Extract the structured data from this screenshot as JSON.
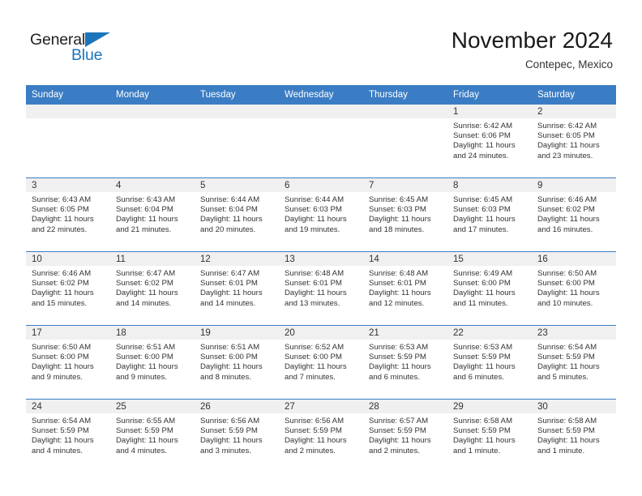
{
  "brand": {
    "name_part1": "General",
    "name_part2": "Blue",
    "logo_shape": "triangle-icon",
    "accent_color": "#1b75bb"
  },
  "header": {
    "title": "November 2024",
    "location": "Contepec, Mexico"
  },
  "theme": {
    "header_row_color": "#3b7dc4",
    "daynum_band_color": "#f0f0f0",
    "text_color": "#333333"
  },
  "calendar": {
    "weekday_headers": [
      "Sunday",
      "Monday",
      "Tuesday",
      "Wednesday",
      "Thursday",
      "Friday",
      "Saturday"
    ],
    "weeks": [
      [
        {
          "day": "",
          "sunrise": "",
          "sunset": "",
          "daylight1": "",
          "daylight2": ""
        },
        {
          "day": "",
          "sunrise": "",
          "sunset": "",
          "daylight1": "",
          "daylight2": ""
        },
        {
          "day": "",
          "sunrise": "",
          "sunset": "",
          "daylight1": "",
          "daylight2": ""
        },
        {
          "day": "",
          "sunrise": "",
          "sunset": "",
          "daylight1": "",
          "daylight2": ""
        },
        {
          "day": "",
          "sunrise": "",
          "sunset": "",
          "daylight1": "",
          "daylight2": ""
        },
        {
          "day": "1",
          "sunrise": "Sunrise: 6:42 AM",
          "sunset": "Sunset: 6:06 PM",
          "daylight1": "Daylight: 11 hours",
          "daylight2": "and 24 minutes."
        },
        {
          "day": "2",
          "sunrise": "Sunrise: 6:42 AM",
          "sunset": "Sunset: 6:05 PM",
          "daylight1": "Daylight: 11 hours",
          "daylight2": "and 23 minutes."
        }
      ],
      [
        {
          "day": "3",
          "sunrise": "Sunrise: 6:43 AM",
          "sunset": "Sunset: 6:05 PM",
          "daylight1": "Daylight: 11 hours",
          "daylight2": "and 22 minutes."
        },
        {
          "day": "4",
          "sunrise": "Sunrise: 6:43 AM",
          "sunset": "Sunset: 6:04 PM",
          "daylight1": "Daylight: 11 hours",
          "daylight2": "and 21 minutes."
        },
        {
          "day": "5",
          "sunrise": "Sunrise: 6:44 AM",
          "sunset": "Sunset: 6:04 PM",
          "daylight1": "Daylight: 11 hours",
          "daylight2": "and 20 minutes."
        },
        {
          "day": "6",
          "sunrise": "Sunrise: 6:44 AM",
          "sunset": "Sunset: 6:03 PM",
          "daylight1": "Daylight: 11 hours",
          "daylight2": "and 19 minutes."
        },
        {
          "day": "7",
          "sunrise": "Sunrise: 6:45 AM",
          "sunset": "Sunset: 6:03 PM",
          "daylight1": "Daylight: 11 hours",
          "daylight2": "and 18 minutes."
        },
        {
          "day": "8",
          "sunrise": "Sunrise: 6:45 AM",
          "sunset": "Sunset: 6:03 PM",
          "daylight1": "Daylight: 11 hours",
          "daylight2": "and 17 minutes."
        },
        {
          "day": "9",
          "sunrise": "Sunrise: 6:46 AM",
          "sunset": "Sunset: 6:02 PM",
          "daylight1": "Daylight: 11 hours",
          "daylight2": "and 16 minutes."
        }
      ],
      [
        {
          "day": "10",
          "sunrise": "Sunrise: 6:46 AM",
          "sunset": "Sunset: 6:02 PM",
          "daylight1": "Daylight: 11 hours",
          "daylight2": "and 15 minutes."
        },
        {
          "day": "11",
          "sunrise": "Sunrise: 6:47 AM",
          "sunset": "Sunset: 6:02 PM",
          "daylight1": "Daylight: 11 hours",
          "daylight2": "and 14 minutes."
        },
        {
          "day": "12",
          "sunrise": "Sunrise: 6:47 AM",
          "sunset": "Sunset: 6:01 PM",
          "daylight1": "Daylight: 11 hours",
          "daylight2": "and 14 minutes."
        },
        {
          "day": "13",
          "sunrise": "Sunrise: 6:48 AM",
          "sunset": "Sunset: 6:01 PM",
          "daylight1": "Daylight: 11 hours",
          "daylight2": "and 13 minutes."
        },
        {
          "day": "14",
          "sunrise": "Sunrise: 6:48 AM",
          "sunset": "Sunset: 6:01 PM",
          "daylight1": "Daylight: 11 hours",
          "daylight2": "and 12 minutes."
        },
        {
          "day": "15",
          "sunrise": "Sunrise: 6:49 AM",
          "sunset": "Sunset: 6:00 PM",
          "daylight1": "Daylight: 11 hours",
          "daylight2": "and 11 minutes."
        },
        {
          "day": "16",
          "sunrise": "Sunrise: 6:50 AM",
          "sunset": "Sunset: 6:00 PM",
          "daylight1": "Daylight: 11 hours",
          "daylight2": "and 10 minutes."
        }
      ],
      [
        {
          "day": "17",
          "sunrise": "Sunrise: 6:50 AM",
          "sunset": "Sunset: 6:00 PM",
          "daylight1": "Daylight: 11 hours",
          "daylight2": "and 9 minutes."
        },
        {
          "day": "18",
          "sunrise": "Sunrise: 6:51 AM",
          "sunset": "Sunset: 6:00 PM",
          "daylight1": "Daylight: 11 hours",
          "daylight2": "and 9 minutes."
        },
        {
          "day": "19",
          "sunrise": "Sunrise: 6:51 AM",
          "sunset": "Sunset: 6:00 PM",
          "daylight1": "Daylight: 11 hours",
          "daylight2": "and 8 minutes."
        },
        {
          "day": "20",
          "sunrise": "Sunrise: 6:52 AM",
          "sunset": "Sunset: 6:00 PM",
          "daylight1": "Daylight: 11 hours",
          "daylight2": "and 7 minutes."
        },
        {
          "day": "21",
          "sunrise": "Sunrise: 6:53 AM",
          "sunset": "Sunset: 5:59 PM",
          "daylight1": "Daylight: 11 hours",
          "daylight2": "and 6 minutes."
        },
        {
          "day": "22",
          "sunrise": "Sunrise: 6:53 AM",
          "sunset": "Sunset: 5:59 PM",
          "daylight1": "Daylight: 11 hours",
          "daylight2": "and 6 minutes."
        },
        {
          "day": "23",
          "sunrise": "Sunrise: 6:54 AM",
          "sunset": "Sunset: 5:59 PM",
          "daylight1": "Daylight: 11 hours",
          "daylight2": "and 5 minutes."
        }
      ],
      [
        {
          "day": "24",
          "sunrise": "Sunrise: 6:54 AM",
          "sunset": "Sunset: 5:59 PM",
          "daylight1": "Daylight: 11 hours",
          "daylight2": "and 4 minutes."
        },
        {
          "day": "25",
          "sunrise": "Sunrise: 6:55 AM",
          "sunset": "Sunset: 5:59 PM",
          "daylight1": "Daylight: 11 hours",
          "daylight2": "and 4 minutes."
        },
        {
          "day": "26",
          "sunrise": "Sunrise: 6:56 AM",
          "sunset": "Sunset: 5:59 PM",
          "daylight1": "Daylight: 11 hours",
          "daylight2": "and 3 minutes."
        },
        {
          "day": "27",
          "sunrise": "Sunrise: 6:56 AM",
          "sunset": "Sunset: 5:59 PM",
          "daylight1": "Daylight: 11 hours",
          "daylight2": "and 2 minutes."
        },
        {
          "day": "28",
          "sunrise": "Sunrise: 6:57 AM",
          "sunset": "Sunset: 5:59 PM",
          "daylight1": "Daylight: 11 hours",
          "daylight2": "and 2 minutes."
        },
        {
          "day": "29",
          "sunrise": "Sunrise: 6:58 AM",
          "sunset": "Sunset: 5:59 PM",
          "daylight1": "Daylight: 11 hours",
          "daylight2": "and 1 minute."
        },
        {
          "day": "30",
          "sunrise": "Sunrise: 6:58 AM",
          "sunset": "Sunset: 5:59 PM",
          "daylight1": "Daylight: 11 hours",
          "daylight2": "and 1 minute."
        }
      ]
    ]
  }
}
